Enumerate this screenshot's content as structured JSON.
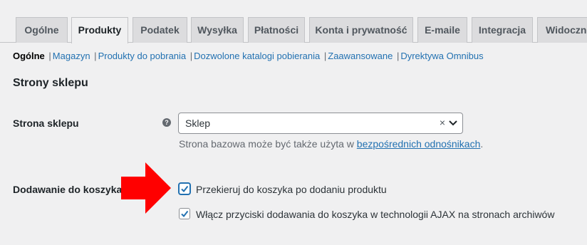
{
  "tabs": [
    {
      "label": "Ogólne",
      "active": false
    },
    {
      "label": "Produkty",
      "active": true
    },
    {
      "label": "Podatek",
      "active": false
    },
    {
      "label": "Wysyłka",
      "active": false
    },
    {
      "label": "Płatności",
      "active": false
    },
    {
      "label": "Konta i prywatność",
      "active": false
    },
    {
      "label": "E-maile",
      "active": false
    },
    {
      "label": "Integracja",
      "active": false
    },
    {
      "label": "Widoczno",
      "active": false
    }
  ],
  "subnav": [
    {
      "label": "Ogólne",
      "current": true
    },
    {
      "label": "Magazyn",
      "current": false
    },
    {
      "label": "Produkty do pobrania",
      "current": false
    },
    {
      "label": "Dozwolone katalogi pobierania",
      "current": false
    },
    {
      "label": "Zaawansowane",
      "current": false
    },
    {
      "label": "Dyrektywa Omnibus",
      "current": false
    }
  ],
  "subnav_separator": "|",
  "section_title": "Strony sklepu",
  "shop_page": {
    "label": "Strona sklepu",
    "help_icon": "question-circle-icon",
    "selected_value": "Sklep",
    "clear_symbol": "×",
    "description_prefix": "Strona bazowa może być także użyta w ",
    "description_link": "bezpośrednich odnośnikach",
    "description_suffix": "."
  },
  "add_to_cart": {
    "label": "Dodawanie do koszyka",
    "options": [
      {
        "label": "Przekieruj do koszyka po dodaniu produktu",
        "checked": true
      },
      {
        "label": "Włącz przyciski dodawania do koszyka w technologii AJAX na stronach archiwów",
        "checked": true
      }
    ]
  },
  "colors": {
    "accent": "#2271b1",
    "arrow": "#ff0000",
    "background": "#f0f0f1"
  }
}
